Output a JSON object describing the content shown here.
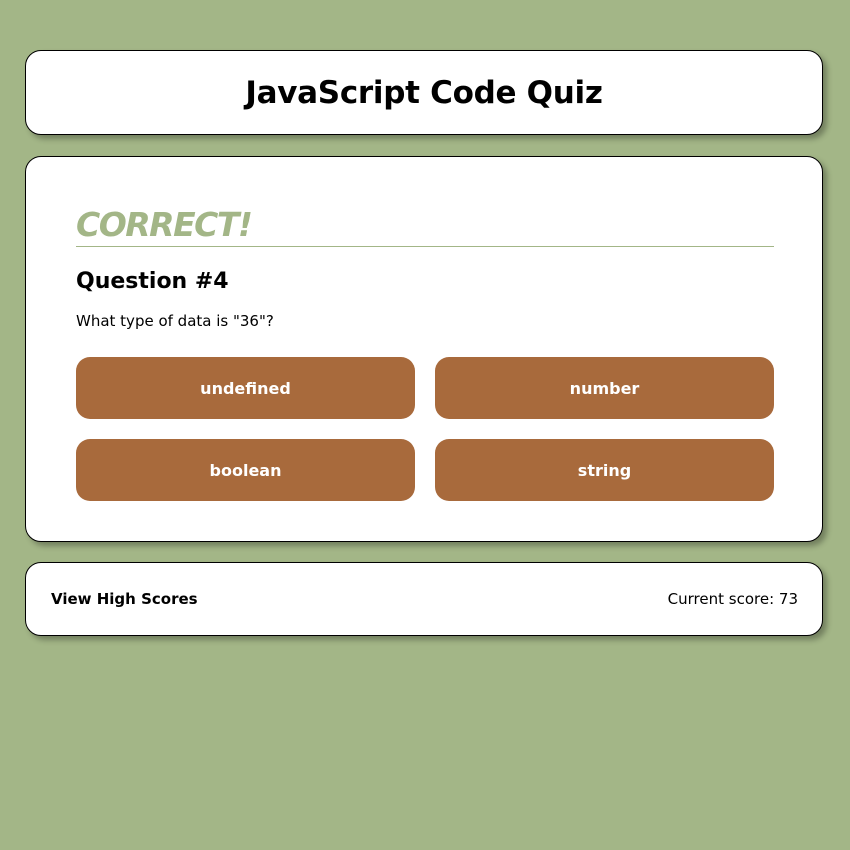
{
  "header": {
    "title": "JavaScript Code Quiz"
  },
  "quiz": {
    "feedback": "CORRECT!",
    "question_title": "Question #4",
    "question_text": "What type of data is \"36\"?",
    "answers": [
      "undefined",
      "number",
      "boolean",
      "string"
    ]
  },
  "footer": {
    "high_scores_label": "View High Scores",
    "score_label": "Current score: 73"
  },
  "colors": {
    "background": "#a3b687",
    "answer_button": "#a86a3c",
    "feedback": "#a3b687"
  }
}
